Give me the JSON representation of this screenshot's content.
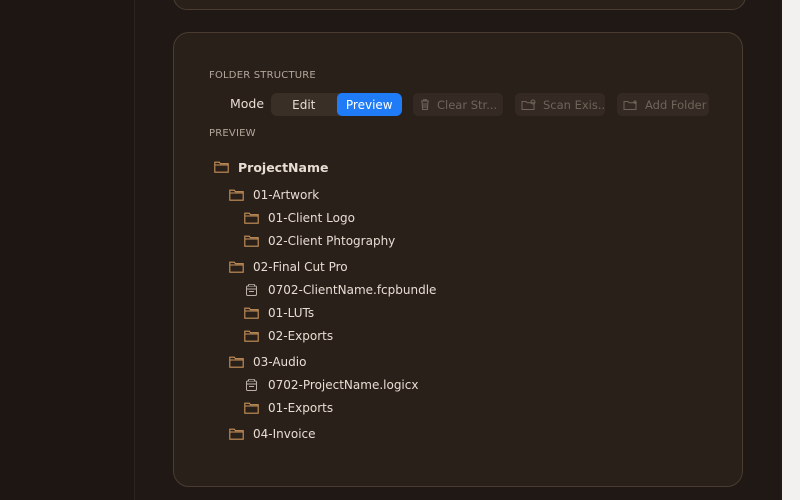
{
  "folder_section": {
    "title": "FOLDER STRUCTURE",
    "mode_label": "Mode",
    "mode_options": [
      "Edit",
      "Preview"
    ],
    "selected_mode": "Preview",
    "buttons": {
      "clear": "Clear Str...",
      "scan": "Scan Exis...",
      "add_folder": "Add Folder"
    }
  },
  "preview": {
    "title": "PREVIEW",
    "root": "ProjectName",
    "items": [
      {
        "label": "01-Artwork",
        "type": "folder",
        "level": 1
      },
      {
        "label": "01-Client Logo",
        "type": "folder",
        "level": 2
      },
      {
        "label": "02-Client Phtography",
        "type": "folder",
        "level": 2
      },
      {
        "label": "02-Final Cut Pro",
        "type": "folder",
        "level": 1
      },
      {
        "label": "0702-ClientName.fcpbundle",
        "type": "bundle",
        "level": 2
      },
      {
        "label": "01-LUTs",
        "type": "folder",
        "level": 2
      },
      {
        "label": "02-Exports",
        "type": "folder",
        "level": 2
      },
      {
        "label": "03-Audio",
        "type": "folder",
        "level": 1
      },
      {
        "label": "0702-ProjectName.logicx",
        "type": "bundle",
        "level": 2
      },
      {
        "label": "01-Exports",
        "type": "folder",
        "level": 2
      },
      {
        "label": "04-Invoice",
        "type": "folder",
        "level": 1
      }
    ]
  },
  "colors": {
    "folder_icon": "#c8935a",
    "accent": "#1f7cf6"
  }
}
